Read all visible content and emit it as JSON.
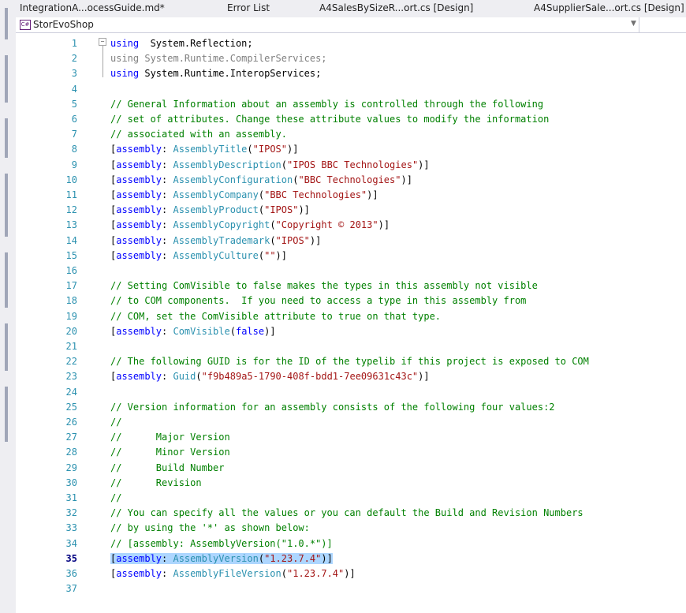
{
  "tabs": [
    {
      "label": "IntegrationA...ocessGuide.md*"
    },
    {
      "label": "Error List"
    },
    {
      "label": "A4SalesBySizeR...ort.cs [Design]"
    },
    {
      "label": "A4SupplierSale...ort.cs [Design]"
    }
  ],
  "navbar": {
    "project": "StorEvoShop",
    "project_icon": "C#"
  },
  "editor": {
    "current_line": 35,
    "lines": [
      {
        "n": "1",
        "segs": [
          [
            "kw",
            "using"
          ],
          [
            "",
            "  System.Reflection;"
          ]
        ]
      },
      {
        "n": "2",
        "segs": [
          [
            "gray",
            "using System.Runtime.CompilerServices;"
          ]
        ]
      },
      {
        "n": "3",
        "segs": [
          [
            "kw",
            "using"
          ],
          [
            "",
            " System.Runtime.InteropServices;"
          ]
        ]
      },
      {
        "n": "4",
        "segs": []
      },
      {
        "n": "5",
        "segs": [
          [
            "cm",
            "// General Information about an assembly is controlled through the following"
          ]
        ]
      },
      {
        "n": "6",
        "segs": [
          [
            "cm",
            "// set of attributes. Change these attribute values to modify the information"
          ]
        ]
      },
      {
        "n": "7",
        "segs": [
          [
            "cm",
            "// associated with an assembly."
          ]
        ]
      },
      {
        "n": "8",
        "segs": [
          [
            "",
            "["
          ],
          [
            "attrkw",
            "assembly"
          ],
          [
            "",
            ": "
          ],
          [
            "type",
            "AssemblyTitle"
          ],
          [
            "",
            "("
          ],
          [
            "str",
            "\"IPOS\""
          ],
          [
            "",
            ")]"
          ]
        ]
      },
      {
        "n": "9",
        "segs": [
          [
            "",
            "["
          ],
          [
            "attrkw",
            "assembly"
          ],
          [
            "",
            ": "
          ],
          [
            "type",
            "AssemblyDescription"
          ],
          [
            "",
            "("
          ],
          [
            "str",
            "\"IPOS BBC Technologies\""
          ],
          [
            "",
            ")]"
          ]
        ]
      },
      {
        "n": "10",
        "segs": [
          [
            "",
            "["
          ],
          [
            "attrkw",
            "assembly"
          ],
          [
            "",
            ": "
          ],
          [
            "type",
            "AssemblyConfiguration"
          ],
          [
            "",
            "("
          ],
          [
            "str",
            "\"BBC Technologies\""
          ],
          [
            "",
            ")]"
          ]
        ]
      },
      {
        "n": "11",
        "segs": [
          [
            "",
            "["
          ],
          [
            "attrkw",
            "assembly"
          ],
          [
            "",
            ": "
          ],
          [
            "type",
            "AssemblyCompany"
          ],
          [
            "",
            "("
          ],
          [
            "str",
            "\"BBC Technologies\""
          ],
          [
            "",
            ")]"
          ]
        ]
      },
      {
        "n": "12",
        "segs": [
          [
            "",
            "["
          ],
          [
            "attrkw",
            "assembly"
          ],
          [
            "",
            ": "
          ],
          [
            "type",
            "AssemblyProduct"
          ],
          [
            "",
            "("
          ],
          [
            "str",
            "\"IPOS\""
          ],
          [
            "",
            ")]"
          ]
        ]
      },
      {
        "n": "13",
        "segs": [
          [
            "",
            "["
          ],
          [
            "attrkw",
            "assembly"
          ],
          [
            "",
            ": "
          ],
          [
            "type",
            "AssemblyCopyright"
          ],
          [
            "",
            "("
          ],
          [
            "str",
            "\"Copyright © 2013\""
          ],
          [
            "",
            ")]"
          ]
        ]
      },
      {
        "n": "14",
        "segs": [
          [
            "",
            "["
          ],
          [
            "attrkw",
            "assembly"
          ],
          [
            "",
            ": "
          ],
          [
            "type",
            "AssemblyTrademark"
          ],
          [
            "",
            "("
          ],
          [
            "str",
            "\"IPOS\""
          ],
          [
            "",
            ")]"
          ]
        ]
      },
      {
        "n": "15",
        "segs": [
          [
            "",
            "["
          ],
          [
            "attrkw",
            "assembly"
          ],
          [
            "",
            ": "
          ],
          [
            "type",
            "AssemblyCulture"
          ],
          [
            "",
            "("
          ],
          [
            "str",
            "\"\""
          ],
          [
            "",
            ")]"
          ]
        ]
      },
      {
        "n": "16",
        "segs": []
      },
      {
        "n": "17",
        "segs": [
          [
            "cm",
            "// Setting ComVisible to false makes the types in this assembly not visible"
          ]
        ]
      },
      {
        "n": "18",
        "segs": [
          [
            "cm",
            "// to COM components.  If you need to access a type in this assembly from"
          ]
        ]
      },
      {
        "n": "19",
        "segs": [
          [
            "cm",
            "// COM, set the ComVisible attribute to true on that type."
          ]
        ]
      },
      {
        "n": "20",
        "segs": [
          [
            "",
            "["
          ],
          [
            "attrkw",
            "assembly"
          ],
          [
            "",
            ": "
          ],
          [
            "type",
            "ComVisible"
          ],
          [
            "",
            "("
          ],
          [
            "kw",
            "false"
          ],
          [
            "",
            ")]"
          ]
        ]
      },
      {
        "n": "21",
        "segs": []
      },
      {
        "n": "22",
        "segs": [
          [
            "cm",
            "// The following GUID is for the ID of the typelib if this project is exposed to COM"
          ]
        ]
      },
      {
        "n": "23",
        "segs": [
          [
            "",
            "["
          ],
          [
            "attrkw",
            "assembly"
          ],
          [
            "",
            ": "
          ],
          [
            "type",
            "Guid"
          ],
          [
            "",
            "("
          ],
          [
            "str",
            "\"f9b489a5-1790-408f-bdd1-7ee09631c43c\""
          ],
          [
            "",
            ")]"
          ]
        ]
      },
      {
        "n": "24",
        "segs": []
      },
      {
        "n": "25",
        "segs": [
          [
            "cm",
            "// Version information for an assembly consists of the following four values:2"
          ]
        ]
      },
      {
        "n": "26",
        "segs": [
          [
            "cm",
            "//"
          ]
        ]
      },
      {
        "n": "27",
        "segs": [
          [
            "cm",
            "//      Major Version"
          ]
        ]
      },
      {
        "n": "28",
        "segs": [
          [
            "cm",
            "//      Minor Version"
          ]
        ]
      },
      {
        "n": "29",
        "segs": [
          [
            "cm",
            "//      Build Number"
          ]
        ]
      },
      {
        "n": "30",
        "segs": [
          [
            "cm",
            "//      Revision"
          ]
        ]
      },
      {
        "n": "31",
        "segs": [
          [
            "cm",
            "//"
          ]
        ]
      },
      {
        "n": "32",
        "segs": [
          [
            "cm",
            "// You can specify all the values or you can default the Build and Revision Numbers"
          ]
        ]
      },
      {
        "n": "33",
        "segs": [
          [
            "cm",
            "// by using the '*' as shown below:"
          ]
        ]
      },
      {
        "n": "34",
        "segs": [
          [
            "cm",
            "// [assembly: AssemblyVersion(\"1.0.*\")]"
          ]
        ]
      },
      {
        "n": "35",
        "segs": [
          [
            "",
            "["
          ],
          [
            "attrkw",
            "assembly"
          ],
          [
            "",
            ": "
          ],
          [
            "type",
            "AssemblyVersion"
          ],
          [
            "",
            "("
          ],
          [
            "str",
            "\"1.23.7.4\""
          ],
          [
            "",
            ")]"
          ]
        ],
        "selected": true
      },
      {
        "n": "36",
        "segs": [
          [
            "",
            "["
          ],
          [
            "attrkw",
            "assembly"
          ],
          [
            "",
            ": "
          ],
          [
            "type",
            "AssemblyFileVersion"
          ],
          [
            "",
            "("
          ],
          [
            "str",
            "\"1.23.7.4\""
          ],
          [
            "",
            ")]"
          ]
        ]
      },
      {
        "n": "37",
        "segs": []
      }
    ]
  },
  "colors": {
    "keyword": "#0000ff",
    "comment": "#008000",
    "string": "#a31515",
    "type": "#2b91af",
    "line_number": "#2b91af",
    "selection": "#add6ff"
  }
}
